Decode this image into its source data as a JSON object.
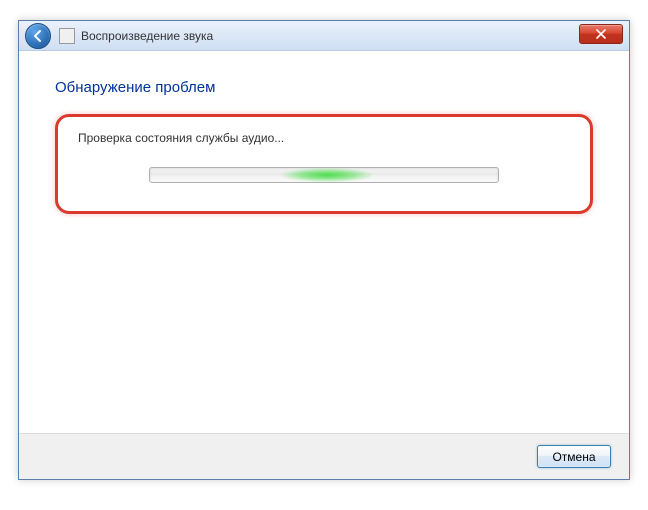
{
  "window": {
    "title": "Воспроизведение звука"
  },
  "content": {
    "heading": "Обнаружение проблем",
    "status": "Проверка состояния службы аудио..."
  },
  "footer": {
    "cancel_label": "Отмена"
  }
}
